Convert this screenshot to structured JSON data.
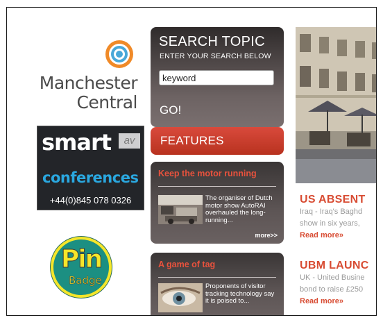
{
  "logos": {
    "manchester_line1": "Manchester",
    "manchester_line2": "Central",
    "smart_title": "smart",
    "smart_av": "av",
    "smart_sub": "conferences",
    "smart_phone": "+44(0)845 078 0326",
    "pin_line1": "Pin",
    "pin_line2": "Badge"
  },
  "search": {
    "title": "SEARCH TOPIC",
    "subtitle": "ENTER YOUR SEARCH BELOW",
    "value": "keyword",
    "go_label": "GO!"
  },
  "features": {
    "title": "FEATURES",
    "cards": [
      {
        "title": "Keep the motor running",
        "text": "The organiser of Dutch motor show AutoRAI overhauled the long-running...",
        "more": "more>>"
      },
      {
        "title": "A game of tag",
        "text": "Proponents of visitor tracking technology say it is poised to..."
      }
    ]
  },
  "news": [
    {
      "headline": "US ABSENT",
      "line1": "Iraq - Iraq's Baghd",
      "line2": "show in six years,",
      "read_more": "Read more»"
    },
    {
      "headline": "UBM LAUNC",
      "line1": "UK - United Busine",
      "line2": "bond to raise £250",
      "read_more": "Read more»"
    }
  ],
  "colors": {
    "accent_red": "#d84c33",
    "panel_dark": "#3a3636",
    "smart_blue": "#2aa8e0",
    "pin_teal": "#1c8f82",
    "pin_yellow": "#f5e62a"
  }
}
